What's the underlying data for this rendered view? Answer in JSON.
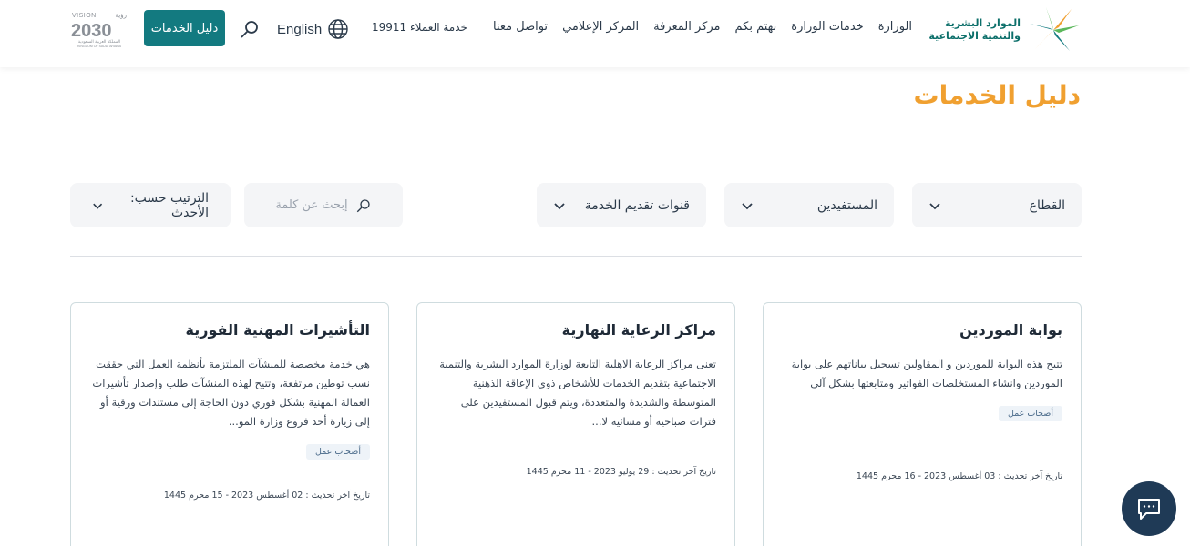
{
  "header": {
    "logo_line1": "الموارد البشرية",
    "logo_line2": "والتنمية الاجتماعية",
    "nav": [
      "الوزارة",
      "خدمات الوزارة",
      "نهتم بكم",
      "مركز المعرفة",
      "المركز الإعلامي",
      "تواصل معنا"
    ],
    "hotline": "خدمة العملاء 19911",
    "language": "English",
    "services_button": "دليل الخدمات",
    "vision_word": "VISION",
    "vision_year": "2030",
    "vision_arabic": "رؤية",
    "vision_sub": "المملكة العربية السعودية",
    "vision_sub_en": "KINGDOM OF SAUDI ARABIA"
  },
  "page": {
    "title": "دليل الخدمات"
  },
  "filters": {
    "sector": "القطاع",
    "beneficiaries": "المستفيدين",
    "channels": "قنوات تقديم الخدمة",
    "search_placeholder": "إبحث عن كلمة",
    "sort": "الترتيب حسب: الأحدث"
  },
  "cards": [
    {
      "title": "بوابة الموردين",
      "description": "تتيح هذه البوابة للموردين و المقاولين تسجيل بياناتهم على بوابة الموردين وانشاء المستخلصات الفواتير ومتابعتها بشكل آلي",
      "badge": "أصحاب عمل",
      "date": "تاريخ آخر تحديث : 03 أغسطس 2023 - 16 محرم 1445"
    },
    {
      "title": "مراكز الرعاية النهارية",
      "description": "تعنى مراكز الرعاية الاهلية التابعة لوزارة الموارد البشرية والتنمية الاجتماعية بتقديم الخدمات للأشخاص ذوي الإعاقة الذهنية المتوسطة والشديدة والمتعددة، ويتم قبول المستفيدين على فترات صباحية أو مسائية لا...",
      "badge": "",
      "date": "تاريخ آخر تحديث : 29 يوليو 2023 - 11 محرم 1445"
    },
    {
      "title": "التأشيرات المهنية الفورية",
      "description": "هي خدمة مخصصة للمنشآت الملتزمة بأنظمة العمل التي حققت نسب توطين مرتفعة، وتتيح لهذه المنشآت طلب وإصدار تأشيرات العمالة المهنية بشكل فوري دون الحاجة إلى مستندات ورقية أو إلى زيارة أحد فروع وزارة المو...",
      "badge": "أصحاب عمل",
      "date": "تاريخ آخر تحديث : 02 أغسطس 2023 - 15 محرم 1445"
    }
  ],
  "colors": {
    "accent": "#f0a030",
    "primary": "#137a80",
    "chat": "#1f3a56"
  },
  "icons": [
    "search-icon",
    "globe-icon",
    "chevron-down-icon",
    "chat-icon"
  ]
}
